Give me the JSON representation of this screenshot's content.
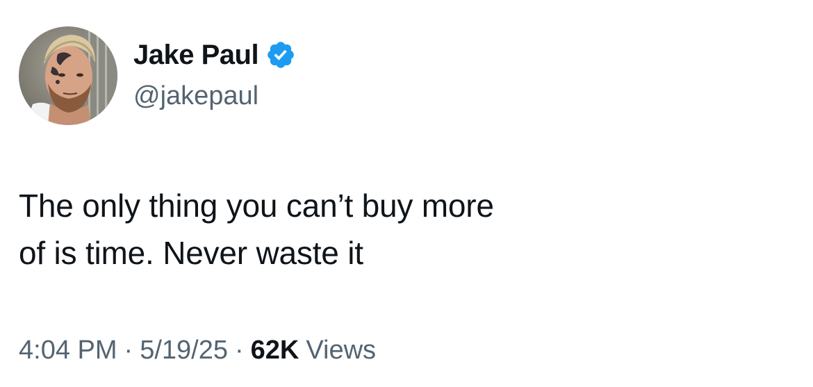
{
  "author": {
    "display_name": "Jake Paul",
    "handle": "@jakepaul",
    "verified": true,
    "verified_icon": "verified-badge-icon",
    "verified_color": "#1d9bf0"
  },
  "tweet": {
    "lines": [
      "The only thing you can’t buy more",
      "of is time. Never waste it"
    ]
  },
  "meta": {
    "time": "4:04 PM",
    "separator": "·",
    "date": "5/19/25",
    "views_count": "62K",
    "views_label": "Views"
  },
  "colors": {
    "text_primary": "#0f1419",
    "text_secondary": "#536471",
    "background": "#ffffff"
  }
}
